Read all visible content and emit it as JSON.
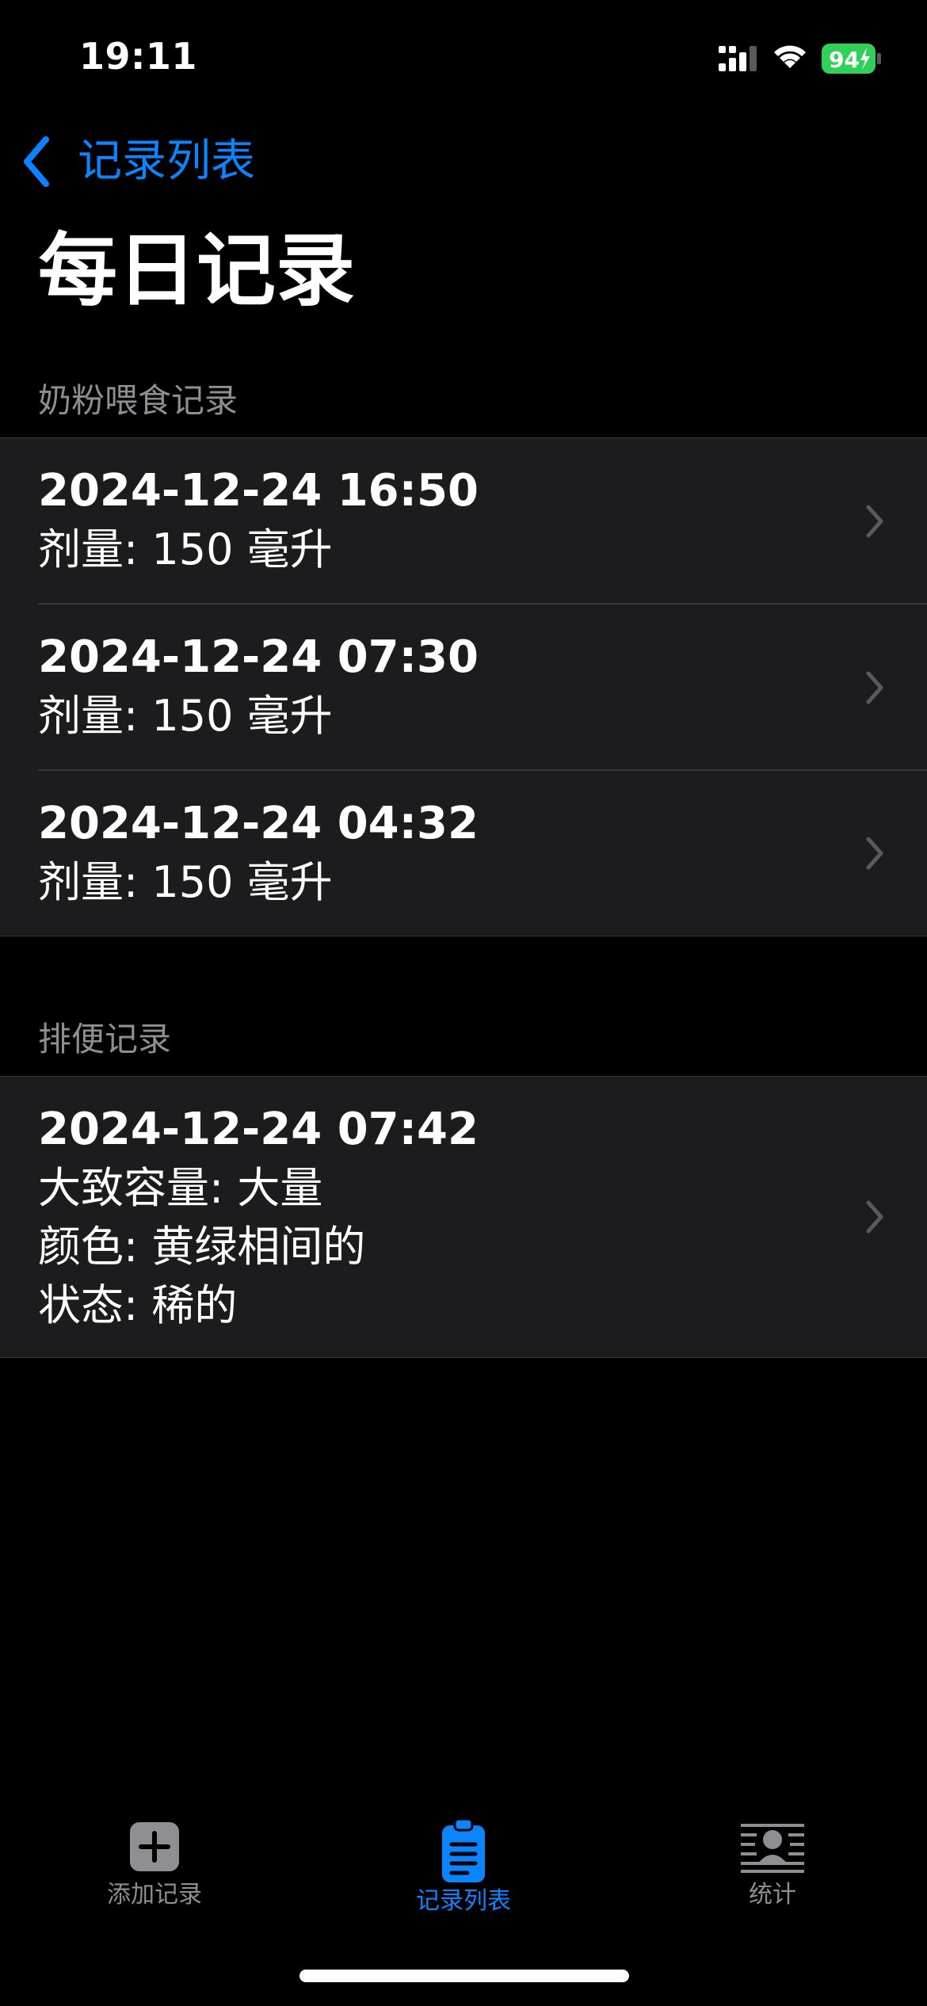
{
  "status_bar": {
    "time": "19:11",
    "battery": "94"
  },
  "nav": {
    "back_label": "记录列表",
    "title": "每日记录"
  },
  "sections": [
    {
      "header": "奶粉喂食记录",
      "rows": [
        {
          "date": "2024-12-24 16:50",
          "lines": [
            "剂量: 150 毫升"
          ]
        },
        {
          "date": "2024-12-24 07:30",
          "lines": [
            "剂量: 150 毫升"
          ]
        },
        {
          "date": "2024-12-24 04:32",
          "lines": [
            "剂量: 150 毫升"
          ]
        }
      ]
    },
    {
      "header": "排便记录",
      "rows": [
        {
          "date": "2024-12-24 07:42",
          "lines": [
            "大致容量: 大量",
            "颜色: 黄绿相间的",
            "状态: 稀的"
          ]
        }
      ]
    }
  ],
  "tab_bar": {
    "tabs": [
      {
        "label": "添加记录",
        "icon": "plus-square-icon",
        "active": false
      },
      {
        "label": "记录列表",
        "icon": "clipboard-icon",
        "active": true
      },
      {
        "label": "统计",
        "icon": "person-stats-icon",
        "active": false
      }
    ]
  },
  "colors": {
    "accent": "#0a84ff",
    "background": "#000000",
    "cell": "#1c1c1e",
    "secondary_text": "#8e8e93",
    "inactive_tab": "#8e8e93",
    "battery": "#30d158"
  }
}
